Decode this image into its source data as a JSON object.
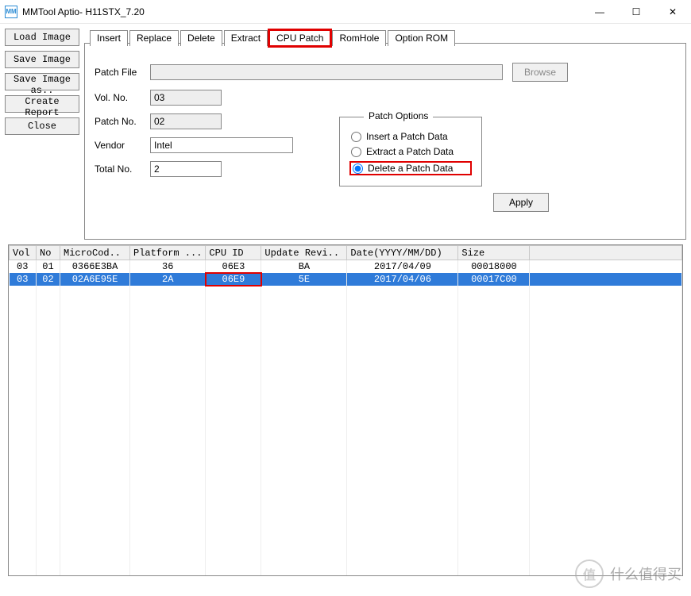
{
  "window": {
    "title": "MMTool Aptio- H11STX_7.20",
    "icon_label": "MM"
  },
  "win_controls": {
    "min": "—",
    "max": "☐",
    "close": "✕"
  },
  "left_buttons": {
    "load": "Load Image",
    "save": "Save Image",
    "saveas": "Save Image as..",
    "report": "Create Report",
    "close": "Close"
  },
  "tabs": {
    "insert": "Insert",
    "replace": "Replace",
    "delete": "Delete",
    "extract": "Extract",
    "cpupatch": "CPU Patch",
    "romhole": "RomHole",
    "optionrom": "Option ROM"
  },
  "form": {
    "patch_file_label": "Patch File",
    "patch_file_value": "",
    "browse": "Browse",
    "vol_no_label": "Vol. No.",
    "vol_no_value": "03",
    "patch_no_label": "Patch No.",
    "patch_no_value": "02",
    "vendor_label": "Vendor",
    "vendor_value": "Intel",
    "total_no_label": "Total No.",
    "total_no_value": "2"
  },
  "patch_options": {
    "legend": "Patch Options",
    "insert": "Insert a Patch Data",
    "extract": "Extract a Patch Data",
    "delete": "Delete a Patch Data",
    "selected": "delete"
  },
  "apply": "Apply",
  "table": {
    "headers": [
      "Vol",
      "No",
      "MicroCod..",
      "Platform ...",
      "CPU ID",
      "Update Revi..",
      "Date(YYYY/MM/DD)",
      "Size"
    ],
    "rows": [
      {
        "vol": "03",
        "no": "01",
        "microcode": "0366E3BA",
        "platform": "36",
        "cpuid": "06E3",
        "update": "BA",
        "date": "2017/04/09",
        "size": "00018000",
        "selected": false
      },
      {
        "vol": "03",
        "no": "02",
        "microcode": "02A6E95E",
        "platform": "2A",
        "cpuid": "06E9",
        "update": "5E",
        "date": "2017/04/06",
        "size": "00017C00",
        "selected": true,
        "highlight_cpuid": true
      }
    ]
  },
  "watermark": {
    "icon": "值",
    "text": "什么值得买"
  }
}
